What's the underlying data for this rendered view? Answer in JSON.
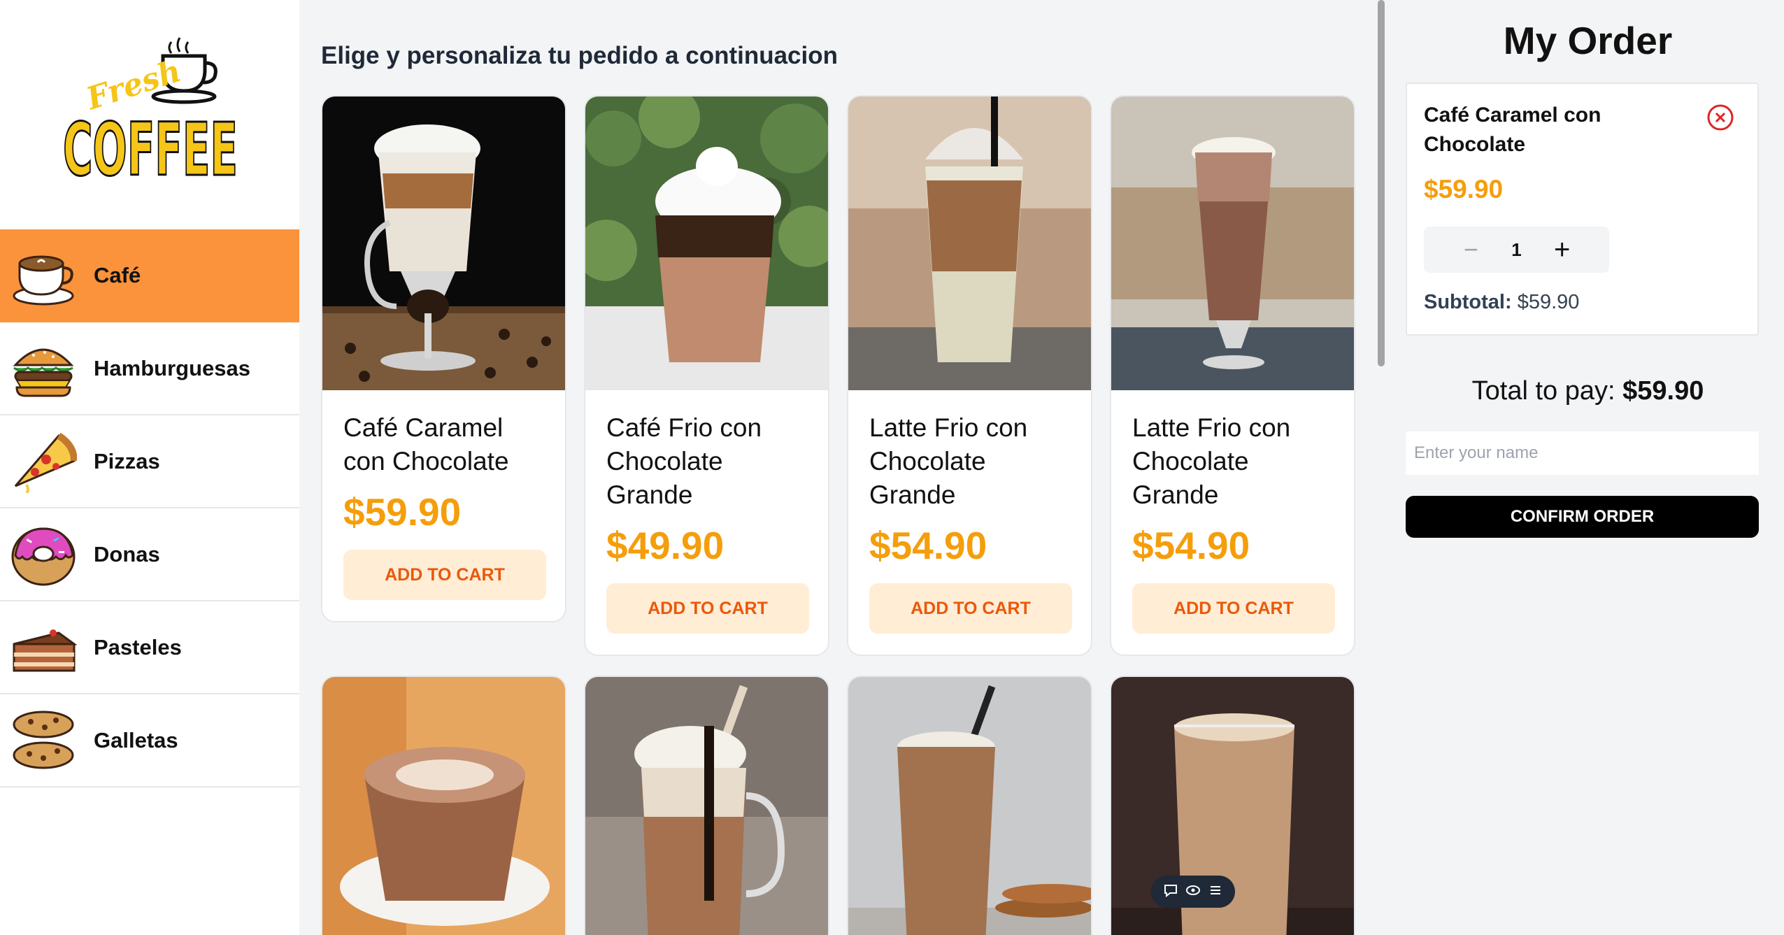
{
  "logo": {
    "top_text": "Fresh",
    "main_text": "COFFEE"
  },
  "sidebar": {
    "items": [
      {
        "label": "Café",
        "icon": "coffee-cup-icon",
        "active": true
      },
      {
        "label": "Hamburguesas",
        "icon": "burger-icon",
        "active": false
      },
      {
        "label": "Pizzas",
        "icon": "pizza-slice-icon",
        "active": false
      },
      {
        "label": "Donas",
        "icon": "donut-icon",
        "active": false
      },
      {
        "label": "Pasteles",
        "icon": "cake-slice-icon",
        "active": false
      },
      {
        "label": "Galletas",
        "icon": "cookies-icon",
        "active": false
      }
    ]
  },
  "main": {
    "subtitle": "Elige y personaliza tu pedido a continuacion",
    "products": [
      {
        "name": "Café Caramel con Chocolate",
        "price": "$59.90",
        "button": "ADD TO CART"
      },
      {
        "name": "Café Frio con Chocolate Grande",
        "price": "$49.90",
        "button": "ADD TO CART"
      },
      {
        "name": "Latte Frio con Chocolate Grande",
        "price": "$54.90",
        "button": "ADD TO CART"
      },
      {
        "name": "Latte Frio con Chocolate Grande",
        "price": "$54.90",
        "button": "ADD TO CART"
      }
    ]
  },
  "order": {
    "title": "My Order",
    "item": {
      "name": "Café Caramel con Chocolate",
      "price": "$59.90",
      "quantity": "1",
      "subtotal_label": "Subtotal:",
      "subtotal_value": "$59.90"
    },
    "total_label": "Total to pay:",
    "total_value": "$59.90",
    "name_placeholder": "Enter your name",
    "confirm_label": "CONFIRM ORDER"
  },
  "colors": {
    "accent_orange": "#fb923c",
    "price_amber": "#f59e0b",
    "button_bg": "#ffedd5",
    "button_text": "#ea580c",
    "remove_red": "#dc2626"
  }
}
